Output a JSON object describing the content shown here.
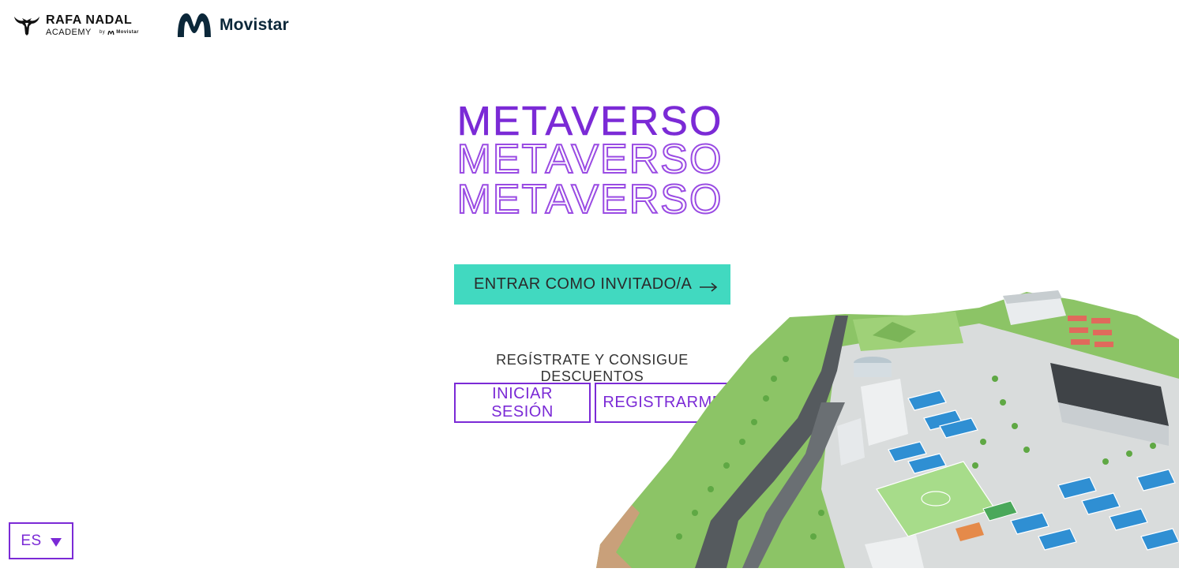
{
  "header": {
    "academy_logo": {
      "title": "RAFA NADAL",
      "subtitle": "ACADEMY",
      "by": "by",
      "partner": "Movistar"
    },
    "sponsor_logo": {
      "name": "Movistar"
    }
  },
  "main": {
    "title_lines": [
      "METAVERSO",
      "METAVERSO",
      "METAVERSO"
    ],
    "guest_button": {
      "label": "ENTRAR COMO INVITADO/A",
      "icon": "arrow-right-icon"
    },
    "promo_text": "REGÍSTRATE Y CONSIGUE DESCUENTOS",
    "login_button": {
      "label": "INICIAR SESIÓN"
    },
    "register_button": {
      "label": "REGISTRARME"
    }
  },
  "language_selector": {
    "value": "ES",
    "icon": "caret-down-icon"
  },
  "illustration": {
    "name": "academy-campus-3d-map"
  },
  "colors": {
    "accent_purple": "#7b2ad6",
    "accent_teal": "#41d9c0",
    "movistar_navy": "#0b2739",
    "grass_green": "#8cc466",
    "court_blue": "#2f8fd3"
  }
}
